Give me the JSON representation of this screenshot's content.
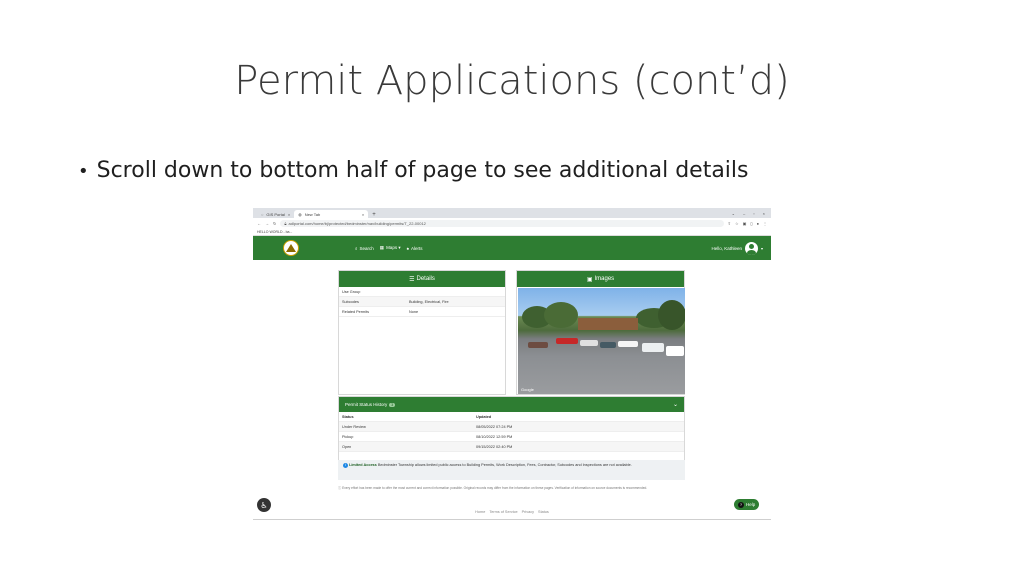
{
  "slide": {
    "title": "Permit Applications (cont’d)",
    "bullet": "Scroll down to bottom half of page to see additional details"
  },
  "browser": {
    "tabs": [
      {
        "label": "GIS Portal",
        "icon": "globe-icon"
      },
      {
        "label": "New Tab",
        "icon": "newtab-icon"
      }
    ],
    "new_tab_symbol": "+",
    "address": "adlportal.com/home/bj/protected/bedminster/nav/building/permits/T_22-00012",
    "bookmark": "HELLO WORLD - ba..."
  },
  "app": {
    "nav": [
      {
        "label": "Search",
        "icon": "search-icon"
      },
      {
        "label": "Maps ▾",
        "icon": "map-icon"
      },
      {
        "label": "Alerts",
        "icon": "bell-icon"
      }
    ],
    "user_greeting": "Hello, Kathleen"
  },
  "details": {
    "title": "Details",
    "rows": [
      {
        "key": "Use Group",
        "value": ""
      },
      {
        "key": "Subcodes",
        "value": "Building, Electrical, Fire"
      },
      {
        "key": "Related Permits",
        "value": "None"
      }
    ]
  },
  "images": {
    "title": "Images",
    "watermark": "Google"
  },
  "status_history": {
    "title": "Permit Status History",
    "count": "3",
    "headers": [
      "Status",
      "Updated"
    ],
    "rows": [
      {
        "status": "Under Review",
        "updated": "08/05/2022 07:24 PM"
      },
      {
        "status": "Pickup",
        "updated": "08/10/2022 12:59 PM"
      },
      {
        "status": "Open",
        "updated": "09/15/2022 02:40 PM"
      }
    ]
  },
  "notice": {
    "label": "Limited Access",
    "text": "Bedminster Township allows limited public access to Building Permits, Work Description, Fees, Contractor, Subcodes and Inspections are not available."
  },
  "disclaimer": "Every effort has been made to offer the most current and correct information possible. Original records may differ from the information on these pages. Verification of information on source documents is recommended.",
  "help_label": "Help",
  "footer": [
    "Home",
    "Terms of Service",
    "Privacy",
    "Status"
  ],
  "colors": {
    "brand_green": "#2e7d32"
  }
}
